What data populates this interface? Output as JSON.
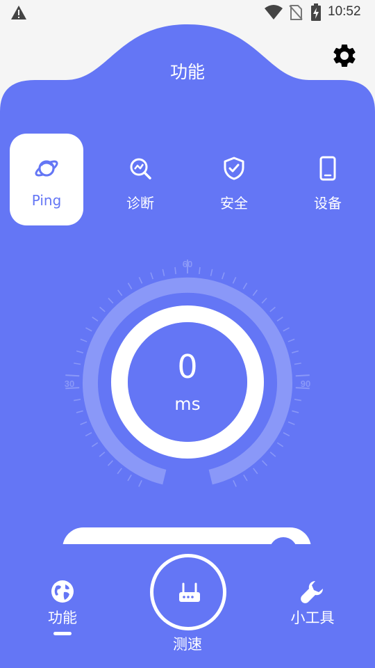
{
  "status_bar": {
    "time": "10:52",
    "icons": [
      "alert-icon",
      "wifi-icon",
      "no-sim-icon",
      "battery-charging-icon"
    ]
  },
  "header": {
    "title": "功能",
    "settings_icon": "gear-icon"
  },
  "tabs": [
    {
      "label": "Ping",
      "icon": "planet-icon",
      "active": true
    },
    {
      "label": "诊断",
      "icon": "magnify-chart-icon",
      "active": false
    },
    {
      "label": "安全",
      "icon": "shield-check-icon",
      "active": false
    },
    {
      "label": "设备",
      "icon": "phone-icon",
      "active": false
    }
  ],
  "gauge": {
    "value": "0",
    "unit": "ms",
    "scale_labels": {
      "left": "30",
      "top": "60",
      "right": "90"
    }
  },
  "bottom_nav": {
    "function_label": "功能",
    "speedtest_label": "测速",
    "tools_label": "小工具"
  },
  "colors": {
    "primary": "#6476F5",
    "ring_light": "#8A98F8",
    "white": "#FFFFFF",
    "status_bg": "#F5F5F5"
  }
}
